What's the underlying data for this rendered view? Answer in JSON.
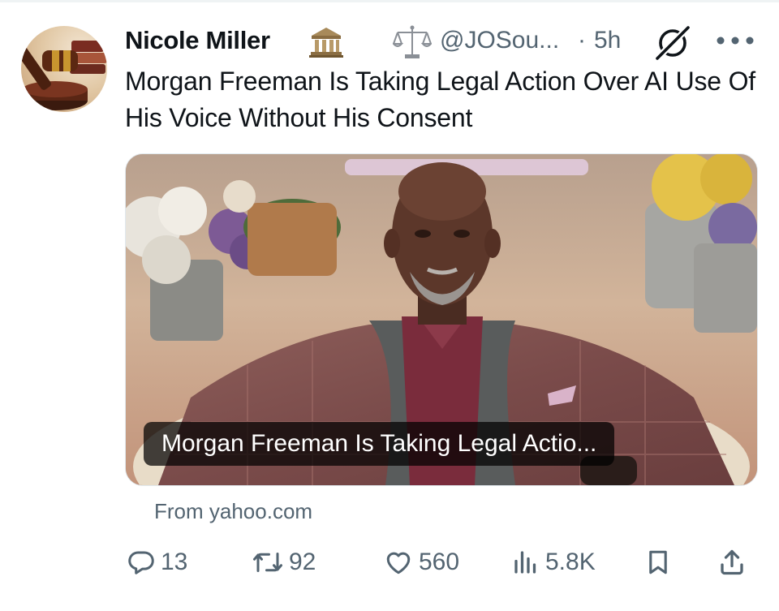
{
  "tweet": {
    "display_name": "Nicole Miller",
    "handle": "@JOSou...",
    "separator": "·",
    "time": "5h",
    "text": "Morgan Freeman Is Taking Legal Action Over AI Use Of His Voice Without His Consent",
    "icons": {
      "badge": "government-building-icon",
      "handle_prefix": "scales-of-justice-icon",
      "grok": "grok-icon",
      "more": "more-icon"
    }
  },
  "card": {
    "caption": "Morgan Freeman Is Taking Legal Actio...",
    "source": "From yahoo.com"
  },
  "actions": {
    "replies": "13",
    "retweets": "92",
    "likes": "560",
    "views": "5.8K"
  },
  "colors": {
    "text": "#0f1419",
    "muted": "#536471",
    "caption_bg": "#000000b8"
  }
}
